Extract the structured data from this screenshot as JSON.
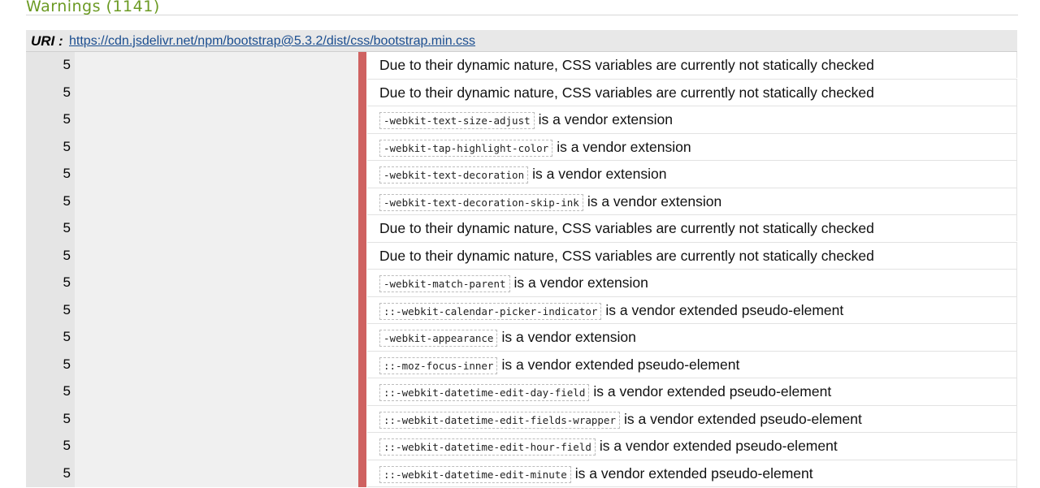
{
  "heading": {
    "title": "Warnings (1141)"
  },
  "uri": {
    "label": "URI :",
    "link": "https://cdn.jsdelivr.net/npm/bootstrap@5.3.2/dist/css/bootstrap.min.css"
  },
  "colors": {
    "heading": "#6b9a23",
    "severity_bar": "#cf6261",
    "link": "#1a4d8f"
  },
  "rows": [
    {
      "line": "5",
      "code": "",
      "text": "Due to their dynamic nature, CSS variables are currently not statically checked"
    },
    {
      "line": "5",
      "code": "",
      "text": "Due to their dynamic nature, CSS variables are currently not statically checked"
    },
    {
      "line": "5",
      "code": "-webkit-text-size-adjust",
      "text": "is a vendor extension"
    },
    {
      "line": "5",
      "code": "-webkit-tap-highlight-color",
      "text": "is a vendor extension"
    },
    {
      "line": "5",
      "code": "-webkit-text-decoration",
      "text": "is a vendor extension"
    },
    {
      "line": "5",
      "code": "-webkit-text-decoration-skip-ink",
      "text": "is a vendor extension"
    },
    {
      "line": "5",
      "code": "",
      "text": "Due to their dynamic nature, CSS variables are currently not statically checked"
    },
    {
      "line": "5",
      "code": "",
      "text": "Due to their dynamic nature, CSS variables are currently not statically checked"
    },
    {
      "line": "5",
      "code": "-webkit-match-parent",
      "text": "is a vendor extension"
    },
    {
      "line": "5",
      "code": "::-webkit-calendar-picker-indicator",
      "text": "is a vendor extended pseudo-element"
    },
    {
      "line": "5",
      "code": "-webkit-appearance",
      "text": "is a vendor extension"
    },
    {
      "line": "5",
      "code": "::-moz-focus-inner",
      "text": "is a vendor extended pseudo-element"
    },
    {
      "line": "5",
      "code": "::-webkit-datetime-edit-day-field",
      "text": "is a vendor extended pseudo-element"
    },
    {
      "line": "5",
      "code": "::-webkit-datetime-edit-fields-wrapper",
      "text": "is a vendor extended pseudo-element"
    },
    {
      "line": "5",
      "code": "::-webkit-datetime-edit-hour-field",
      "text": "is a vendor extended pseudo-element"
    },
    {
      "line": "5",
      "code": "::-webkit-datetime-edit-minute",
      "text": "is a vendor extended pseudo-element"
    }
  ]
}
